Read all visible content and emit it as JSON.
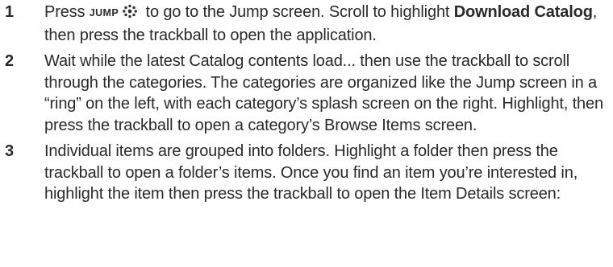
{
  "steps": [
    {
      "number": "1",
      "parts": {
        "a": "Press ",
        "key": "JUMP",
        "b": " to go to the Jump screen. Scroll to highlight ",
        "bold": "Download Catalog",
        "c": ", then press the trackball to open the application."
      }
    },
    {
      "number": "2",
      "text": "Wait while the latest Catalog contents load... then use the trackball to scroll through the categories. The categories are organized like the Jump screen in a “ring” on the left, with each category’s splash screen on the right. Highlight, then press the trackball to open a category’s Browse Items screen."
    },
    {
      "number": "3",
      "text": "Individual items are grouped into folders. Highlight a folder then press the trackball to open a folder’s items. Once you find an item you’re interested in, highlight the item then press the trackball to open the Item Details screen:"
    }
  ],
  "icons": {
    "jump_key_icon": "jump-key-icon"
  }
}
